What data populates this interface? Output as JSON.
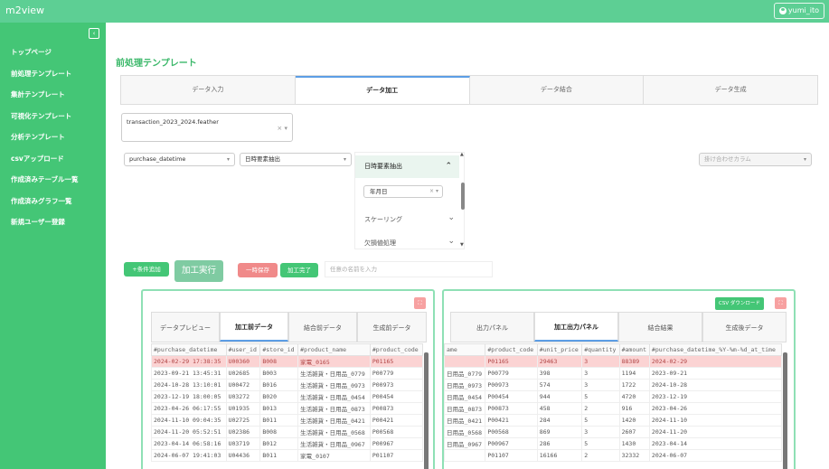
{
  "app": {
    "brand": "m2view",
    "user": "yumi_ito"
  },
  "sidebar": {
    "toggle": "‹",
    "items": [
      "トップページ",
      "前処理テンプレート",
      "集計テンプレート",
      "可視化テンプレート",
      "分析テンプレート",
      "csvアップロード",
      "作成済みテーブル一覧",
      "作成済みグラフ一覧",
      "新規ユーザー登録"
    ]
  },
  "main": {
    "title": "前処理テンプレート",
    "tabs": [
      "データ入力",
      "データ加工",
      "データ結合",
      "データ生成"
    ],
    "active_tab": "データ加工",
    "file": {
      "value": "transaction_2023_2024.feather",
      "controls": "× ▾"
    },
    "column_select": "purchase_datetime",
    "operation_select": "日時要素抽出",
    "combine_select_placeholder": "掛け合わせカラム",
    "accordion": {
      "header": "日時要素抽出",
      "inner_value": "年月日",
      "items": [
        "スケーリング",
        "欠損値処理"
      ]
    },
    "actions": {
      "add": "+条件追加",
      "run": "加工実行",
      "save": "一時保存",
      "done": "加工完了",
      "name_placeholder": "任意の名前を入力"
    }
  },
  "left_panel": {
    "tabs": [
      "データプレビュー",
      "加工前データ",
      "結合前データ",
      "生成前データ"
    ],
    "active_tab": "加工前データ",
    "columns": [
      "#purchase_datetime",
      "#user_id",
      "#store_id",
      "#product_name",
      "#product_code"
    ],
    "rows": [
      [
        "2024-02-29 17:38:35",
        "U00360",
        "B008",
        "家電_0165",
        "P01165"
      ],
      [
        "2023-09-21 13:45:31",
        "U02685",
        "B003",
        "生活雑貨・日用品_0779",
        "P00779"
      ],
      [
        "2024-10-28 13:10:01",
        "U00472",
        "B016",
        "生活雑貨・日用品_0973",
        "P00973"
      ],
      [
        "2023-12-19 18:00:05",
        "U03272",
        "B020",
        "生活雑貨・日用品_0454",
        "P00454"
      ],
      [
        "2023-04-26 06:17:55",
        "U01935",
        "B013",
        "生活雑貨・日用品_0873",
        "P00873"
      ],
      [
        "2024-11-10 09:04:35",
        "U02725",
        "B011",
        "生活雑貨・日用品_0421",
        "P00421"
      ],
      [
        "2024-11-20 05:52:51",
        "U02386",
        "B008",
        "生活雑貨・日用品_0568",
        "P00568"
      ],
      [
        "2023-04-14 06:58:16",
        "U03719",
        "B012",
        "生活雑貨・日用品_0967",
        "P00967"
      ],
      [
        "2024-06-07 19:41:03",
        "U04436",
        "B011",
        "家電_0107",
        "P01107"
      ]
    ]
  },
  "right_panel": {
    "csv_button": "CSV ダウンロード",
    "tabs": [
      "出力パネル",
      "加工出力パネル",
      "結合結果",
      "生成後データ"
    ],
    "active_tab": "加工出力パネル",
    "columns": [
      "ame",
      "#product_code",
      "#unit_price",
      "#quantity",
      "#amount",
      "#purchase_datetime_%Y-%m-%d_at_time"
    ],
    "rows": [
      [
        "",
        "P01165",
        "29463",
        "3",
        "88389",
        "2024-02-29"
      ],
      [
        "日用品_0779",
        "P00779",
        "398",
        "3",
        "1194",
        "2023-09-21"
      ],
      [
        "日用品_0973",
        "P00973",
        "574",
        "3",
        "1722",
        "2024-10-28"
      ],
      [
        "日用品_0454",
        "P00454",
        "944",
        "5",
        "4720",
        "2023-12-19"
      ],
      [
        "日用品_0873",
        "P00873",
        "458",
        "2",
        "916",
        "2023-04-26"
      ],
      [
        "日用品_0421",
        "P00421",
        "284",
        "5",
        "1420",
        "2024-11-10"
      ],
      [
        "日用品_0568",
        "P00568",
        "869",
        "3",
        "2607",
        "2024-11-20"
      ],
      [
        "日用品_0967",
        "P00967",
        "286",
        "5",
        "1430",
        "2023-04-14"
      ],
      [
        "",
        "P01107",
        "16166",
        "2",
        "32332",
        "2024-06-07"
      ]
    ]
  }
}
